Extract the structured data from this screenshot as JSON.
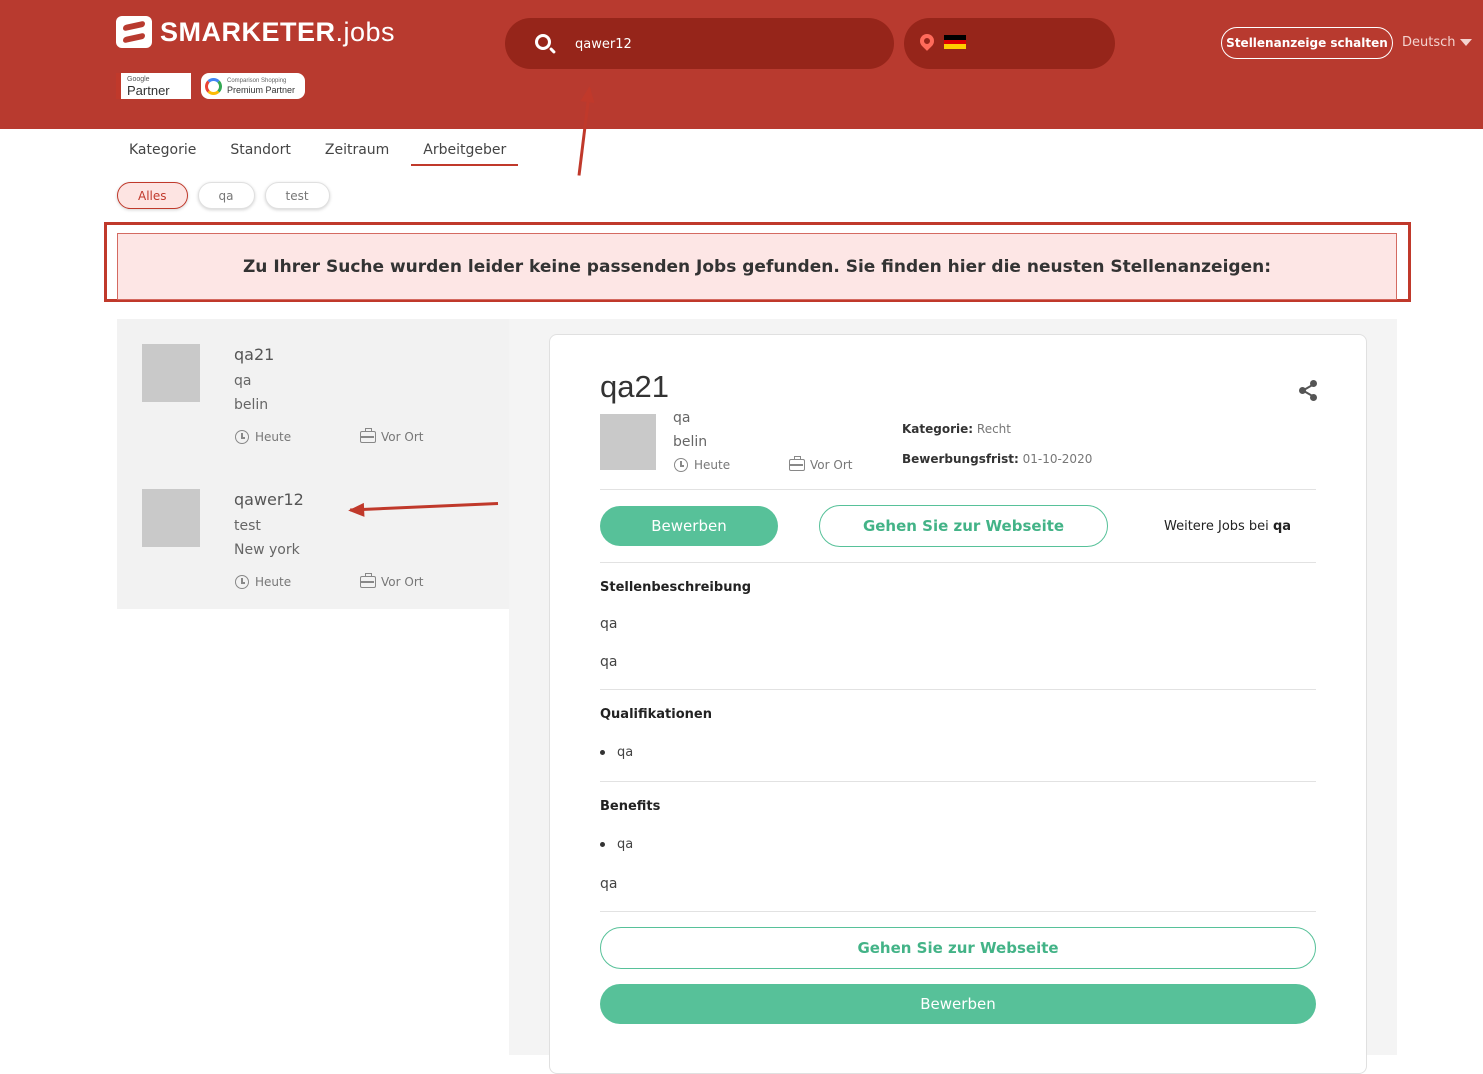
{
  "header": {
    "logo_brand": "SMARKETER",
    "logo_suffix": ".jobs",
    "google_partner_small": "Google",
    "google_partner_big": "Partner",
    "premium_small": "Comparison Shopping",
    "premium_big": "Premium Partner",
    "search_value": "qawer12",
    "advert_button": "Stellenanzeige schalten",
    "language": "Deutsch",
    "flag_colors": [
      "#000000",
      "#dd0000",
      "#ffce00"
    ]
  },
  "tabs": [
    {
      "label": "Kategorie"
    },
    {
      "label": "Standort"
    },
    {
      "label": "Zeitraum"
    },
    {
      "label": "Arbeitgeber"
    }
  ],
  "chips": [
    {
      "label": "Alles"
    },
    {
      "label": "qa"
    },
    {
      "label": "test"
    }
  ],
  "notice": "Zu Ihrer Suche wurden leider keine passenden Jobs gefunden. Sie finden hier die neusten Stellenanzeigen:",
  "jobs": [
    {
      "title": "qa21",
      "company": "qa",
      "location": "belin",
      "date": "Heute",
      "type": "Vor Ort"
    },
    {
      "title": "qawer12",
      "company": "test",
      "location": "New york",
      "date": "Heute",
      "type": "Vor Ort"
    }
  ],
  "detail": {
    "title": "qa21",
    "company": "qa",
    "location": "belin",
    "date": "Heute",
    "type": "Vor Ort",
    "category_label": "Kategorie:",
    "category_value": "Recht",
    "deadline_label": "Bewerbungsfrist:",
    "deadline_value": "01-10-2020",
    "apply_button": "Bewerben",
    "website_button": "Gehen Sie zur Webseite",
    "more_jobs_prefix": "Weitere Jobs bei",
    "more_jobs_company": "qa",
    "sections": {
      "description_title": "Stellenbeschreibung",
      "description_line1": "qa",
      "description_line2": "qa",
      "qualifications_title": "Qualifikationen",
      "qualifications_item": "qa",
      "benefits_title": "Benefits",
      "benefits_item": "qa",
      "benefits_text": "qa"
    }
  },
  "colors": {
    "brand_red": "#b83a2f",
    "search_dark": "#96251a",
    "accent_green": "#57c199"
  }
}
